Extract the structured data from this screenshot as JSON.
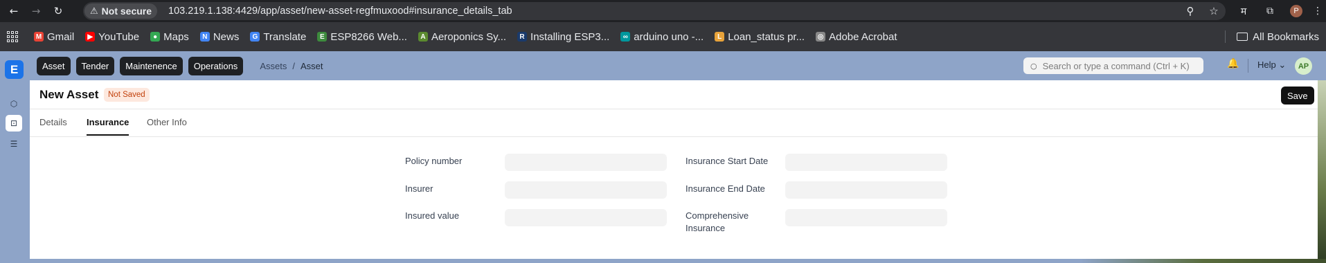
{
  "browser": {
    "security_label": "Not secure",
    "url": "103.219.1.138:4429/app/asset/new-asset-regfmuxood#insurance_details_tab",
    "profile_initial": "P",
    "bookmarks": [
      {
        "label": "Gmail",
        "color": "#ea4335",
        "glyph": "M"
      },
      {
        "label": "YouTube",
        "color": "#ff0000",
        "glyph": "▶"
      },
      {
        "label": "Maps",
        "color": "#34a853",
        "glyph": "●"
      },
      {
        "label": "News",
        "color": "#4285f4",
        "glyph": "N"
      },
      {
        "label": "Translate",
        "color": "#4285f4",
        "glyph": "G"
      },
      {
        "label": "ESP8266 Web...",
        "color": "#3d8b3d",
        "glyph": "E"
      },
      {
        "label": "Aeroponics Sy...",
        "color": "#5b8a2f",
        "glyph": "A"
      },
      {
        "label": "Installing ESP3...",
        "color": "#1a3a6b",
        "glyph": "R"
      },
      {
        "label": "arduino uno -...",
        "color": "#00979d",
        "glyph": "∞"
      },
      {
        "label": "Loan_status pr...",
        "color": "#e8a33a",
        "glyph": "L"
      },
      {
        "label": "Adobe Acrobat",
        "color": "#888888",
        "glyph": "◎"
      }
    ],
    "all_bookmarks_label": "All Bookmarks"
  },
  "app": {
    "logo_letter": "E",
    "nav_pills": [
      "Asset",
      "Tender",
      "Maintenence",
      "Operations"
    ],
    "breadcrumb": {
      "parent": "Assets",
      "separator": "/",
      "current": "Asset"
    },
    "search_placeholder": "Search or type a command (Ctrl + K)",
    "help_label": "Help ⌄",
    "avatar_initials": "AP"
  },
  "page": {
    "title": "New Asset",
    "status_badge": "Not Saved",
    "save_label": "Save",
    "tabs": [
      "Details",
      "Insurance",
      "Other Info"
    ],
    "active_tab": "Insurance",
    "fields_left": [
      {
        "label": "Policy number",
        "value": ""
      },
      {
        "label": "Insurer",
        "value": ""
      },
      {
        "label": "Insured value",
        "value": ""
      }
    ],
    "fields_right": [
      {
        "label": "Insurance Start Date",
        "value": ""
      },
      {
        "label": "Insurance End Date",
        "value": ""
      },
      {
        "label": "Comprehensive Insurance",
        "value": ""
      }
    ]
  },
  "colors": {
    "accent": "#1b73e8",
    "navbar": "#8ea4c8",
    "pill": "#1f2124",
    "badge_bg": "#fde8de",
    "badge_text": "#c2410c"
  }
}
